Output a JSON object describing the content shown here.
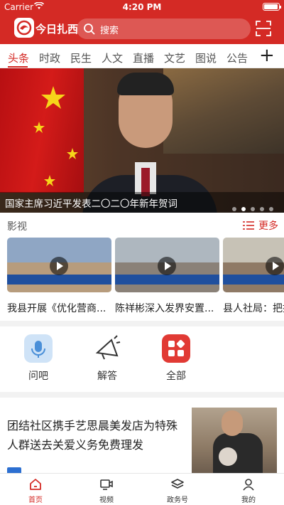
{
  "status_bar": {
    "carrier": "Carrier",
    "time": "4:20 PM"
  },
  "header": {
    "brand": "今日扎西",
    "search_placeholder": "搜索",
    "accent_color": "#d42a25"
  },
  "tabs": [
    {
      "label": "头条",
      "active": true
    },
    {
      "label": "时政"
    },
    {
      "label": "民生"
    },
    {
      "label": "人文"
    },
    {
      "label": "直播"
    },
    {
      "label": "文艺"
    },
    {
      "label": "图说"
    },
    {
      "label": "公告"
    }
  ],
  "hero": {
    "caption": "国家主席习近平发表二〇二〇年新年贺词",
    "slide_count": 5,
    "active_slide": 2
  },
  "video_section": {
    "title": "影视",
    "more_label": "更多",
    "items": [
      {
        "title": "我县开展《优化营商..."
      },
      {
        "title": "陈祥彬深入发界安置..."
      },
      {
        "title": "县人社局：把握"
      }
    ]
  },
  "quick_entries": [
    {
      "label": "问吧",
      "icon": "microphone-icon"
    },
    {
      "label": "解答",
      "icon": "megaphone-icon"
    },
    {
      "label": "全部",
      "icon": "grid-apps-icon"
    }
  ],
  "news": {
    "title": "团结社区携手艺思晨美发店为特殊人群送去关爱义务免费理发"
  },
  "bottom_nav": [
    {
      "label": "首页",
      "icon": "home-icon",
      "active": true
    },
    {
      "label": "视频",
      "icon": "video-icon"
    },
    {
      "label": "政务号",
      "icon": "layers-icon"
    },
    {
      "label": "我的",
      "icon": "user-icon"
    }
  ]
}
